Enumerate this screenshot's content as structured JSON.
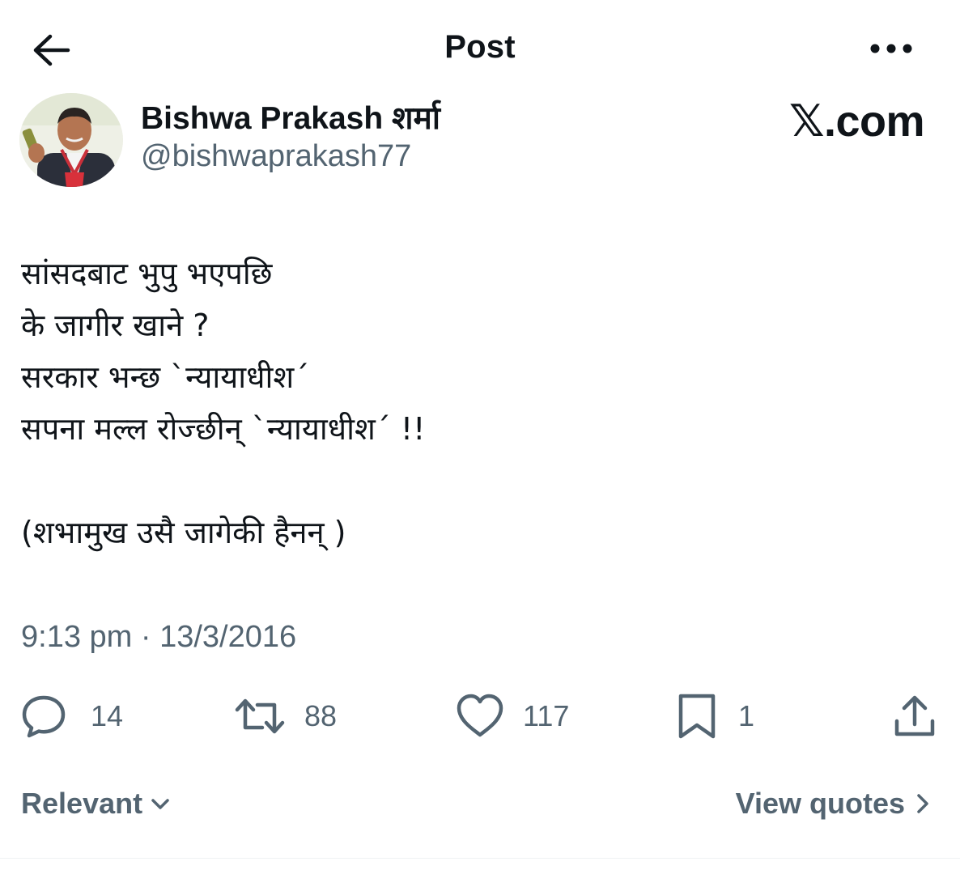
{
  "header": {
    "title": "Post",
    "back_icon": "arrow-left-icon",
    "more_icon": "more-horizontal-icon"
  },
  "author": {
    "name": "Bishwa Prakash शर्मा",
    "handle": "@bishwaprakash77"
  },
  "brand": {
    "label": "𝕏.com"
  },
  "post": {
    "lines": [
      "सांसदबाट भुपु भएपछि",
      "के जागीर खाने ?",
      "सरकार भन्छ `न्यायाधीश´",
      "सपना मल्ल रोज्छीन् `न्यायाधीश´ !!",
      "",
      "(शभामुख उसै जागेकी हैनन् )"
    ],
    "timestamp": "9:13 pm · 13/3/2016"
  },
  "actions": {
    "replies": "14",
    "reposts": "88",
    "likes": "117",
    "bookmarks": "1"
  },
  "footer": {
    "sort_label": "Relevant",
    "quotes_label": "View quotes"
  },
  "colors": {
    "text": "#0f1419",
    "secondary": "#536471",
    "divider": "#eff3f4"
  }
}
